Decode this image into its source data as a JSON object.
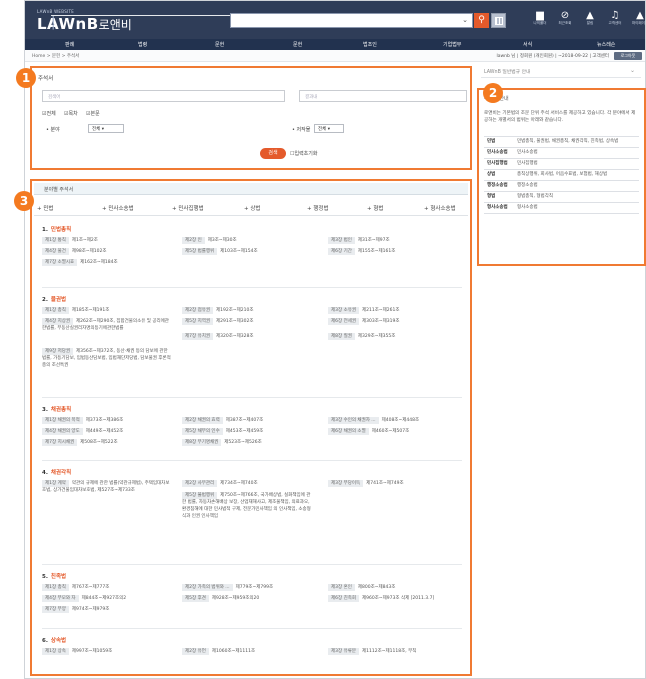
{
  "header": {
    "logo_small": "LAWnB WEBSITE",
    "logo_name": "LAWnB",
    "logo_kr": "로앤비",
    "icons": [
      {
        "name": "folder-icon",
        "glyph": "▆",
        "label": "나의폴더"
      },
      {
        "name": "history-icon",
        "glyph": "⊘",
        "label": "최근조회"
      },
      {
        "name": "bell-icon",
        "glyph": "▲",
        "label": "알림"
      },
      {
        "name": "headset-icon",
        "glyph": "♫",
        "label": "고객센터"
      },
      {
        "name": "user-icon",
        "glyph": "▲",
        "label": "마이페이지"
      }
    ]
  },
  "nav": [
    "판례",
    "법령",
    "문헌",
    "문헌",
    "법조인",
    "기업법무",
    "서식",
    "뉴스레슨"
  ],
  "breadcrumb": {
    "path": "Home > 문헌 > 주석서",
    "account": "lawnb 님 | 정회원 (개인회원) | ~2018-09-22 | 고객센터",
    "logout": "로그아웃"
  },
  "panel1": {
    "title": "주석서",
    "ph1": "검색어",
    "ph2": "결과내",
    "check_all": "전체",
    "check_toc": "목차",
    "check_body": "본문",
    "field_label": "• 분야",
    "field_value": "전체",
    "pub_label": "• 저작물",
    "pub_value": "전체",
    "search_btn": "검색",
    "reset": "입력초기화"
  },
  "side": {
    "top": "LAWnB 일반법규 안내",
    "title": "주석서 안내",
    "desc": "로앤비는 기본법의 조문 단위 주석 서비스를 제공하고 있습니다. 각 분야에서 제공하는 개별서의 범위는 아래와 같습니다.",
    "rows": [
      {
        "k": "민법",
        "v": "민법총칙, 물권법, 채권총칙, 채권각칙, 친족법, 상속법"
      },
      {
        "k": "민사소송법",
        "v": "민사소송법"
      },
      {
        "k": "민사집행법",
        "v": "민사집행법"
      },
      {
        "k": "상법",
        "v": "총칙상행위, 회사법, 어음수표법, 보험법, 해상법"
      },
      {
        "k": "행정소송법",
        "v": "행정소송법"
      },
      {
        "k": "형법",
        "v": "형법총칙, 형법각칙"
      },
      {
        "k": "형사소송법",
        "v": "형사소송법"
      }
    ]
  },
  "panel3": {
    "title": "분야별 주석서",
    "tabs": [
      "+ 민법",
      "+ 민사소송법",
      "+ 민사집행법",
      "+ 상법",
      "+ 행정법",
      "+ 형법",
      "+ 형사소송법"
    ],
    "laws": [
      {
        "idx": "1.",
        "name": "민법총칙",
        "chapters": [
          [
            "제1장 통칙",
            "제1조~제2조"
          ],
          [
            "제2장 인",
            "제3조~제30조"
          ],
          [
            "제3장 법인",
            "제31조~제97조"
          ],
          [
            "제4장 물건",
            "제98조~제102조"
          ],
          [
            "제5장 법률행위",
            "제103조~제154조"
          ],
          [
            "제6장 기간",
            "제155조~제161조"
          ],
          [
            "제7장 소멸시효",
            "제162조~제184조"
          ]
        ]
      },
      {
        "idx": "2.",
        "name": "물권법",
        "chapters": [
          [
            "제1장 총칙",
            "제185조~제191조"
          ],
          [
            "제2장 점유권",
            "제192조~제210조"
          ],
          [
            "제3장 소유권",
            "제211조~제261조"
          ],
          [
            "제4장 지상권",
            "제262조~제290조, 집합건물의소유 및 공리에관한법률, 부동산실권리자명의등기에관한법률"
          ],
          [
            "제5장 지역권",
            "제291조~제302조"
          ],
          [
            "제6장 전세권",
            "제303조~제319조"
          ],
          [
            "제7장 유치권",
            "제320조~제328조"
          ],
          [
            "제8장 질권",
            "제329조~제355조"
          ],
          [
            "제9장 저당권",
            "제356조~제372조, 동산·채권 등의 담보에 관한 법률, 가등기담보, 입법동산담보법, 입법재단저당법, 담보물권 후론적충의 조선특권"
          ]
        ]
      },
      {
        "idx": "3.",
        "name": "채권총칙",
        "chapters": [
          [
            "제1장 채권의 목적",
            "제373조~제386조"
          ],
          [
            "제2장 채권의 효력",
            "제387조~제407조"
          ],
          [
            "제3장 수인의 채권자 ...",
            "제408조~제448조"
          ],
          [
            "제4장 채권의 양도",
            "제449조~제452조"
          ],
          [
            "제5장 채무의 인수",
            "제453조~제459조"
          ],
          [
            "제6장 채권의 소멸",
            "제460조~제507조"
          ],
          [
            "제7장 지시채권",
            "제508조~제522조"
          ],
          [
            "제8장 무기명채권",
            "제523조~제526조"
          ]
        ]
      },
      {
        "idx": "4.",
        "name": "채권각칙",
        "chapters": [
          [
            "제1장 계약",
            "약관의 규제에 관한 법률(약관규제법), 주택임대차보호법, 상가건물임대차보호법, 제527조~제733조"
          ],
          [
            "제2장 사무관리",
            "제734조~제740조"
          ],
          [
            "제3장 부당이득",
            "제741조~제749조"
          ],
          [
            "제5장 불법행위",
            "제750조~제766조, 국가배상법, 실화책임에 관한 법률, 자동차손해배상 보장, 산업재해사고, 제조물책임, 의료과오, 환경침해에 대한 민사법적 구제, 전문가민사책임 의 인사책임, 소송형식과 인권 인사책임"
          ]
        ]
      },
      {
        "idx": "5.",
        "name": "친족법",
        "chapters": [
          [
            "제1장 총칙",
            "제767조~제777조"
          ],
          [
            "제2장 가족의 범위와 ...",
            "제779조~제799조"
          ],
          [
            "제3장 혼인",
            "제800조~제843조"
          ],
          [
            "제4장 부모와 자",
            "제844조~제927조의2"
          ],
          [
            "제5장 후견",
            "제928조~제959조의20"
          ],
          [
            "제6장 친족회",
            "제960조~제973조 삭제 [2011.3.7]"
          ],
          [
            "제7장 부양",
            "제974조~제979조"
          ]
        ]
      },
      {
        "idx": "6.",
        "name": "상속법",
        "chapters": [
          [
            "제1장 상속",
            "제997조~제1059조"
          ],
          [
            "제2장 유언",
            "제1060조~제1111조"
          ],
          [
            "제3장 유류분",
            "제1112조~제1118조, 부칙"
          ]
        ]
      }
    ]
  },
  "badges": [
    "1",
    "2",
    "3"
  ],
  "colors": {
    "accent": "#e45a2b",
    "badge": "#f47a20",
    "topbar": "#2f3d58"
  }
}
